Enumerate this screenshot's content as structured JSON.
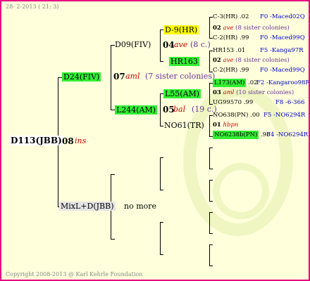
{
  "header_text": "28-  2-2013 ( 21:  3)",
  "copyright": "Copyright 2008-2013 @ Karl Kehrle Foundation",
  "root": {
    "label": "D113(JBB)",
    "year": "08",
    "note": "ins"
  },
  "sire": {
    "label": "D24(FIV)",
    "year": "07",
    "note": "aml",
    "sisters": "(7 sister colonies)"
  },
  "dam_line": {
    "label": "MixL+D(JBB)",
    "note": "no more"
  },
  "gen3": {
    "d09": {
      "label": "D09(FIV)",
      "year": "04",
      "note": "ave",
      "sisters": "(8 c.)"
    },
    "l244": {
      "label": "L244(AM)",
      "year": "05",
      "note": "bal",
      "sisters": "(19 c.)"
    }
  },
  "gen4": {
    "d9": {
      "label": "D-9(HR)",
      "year": "02",
      "note": "ave",
      "sisters": "(8 sister colonies)"
    },
    "hr163": {
      "label": "HR163",
      "year": "02",
      "note": "ave",
      "sisters": "(8 sister colonies)"
    },
    "l55": {
      "label": "L55(AM)",
      "year": "03",
      "note": "aml",
      "sisters": "(10 sister colonies)"
    },
    "no61": {
      "label": "NO61(TR)",
      "year": "01",
      "note": "hbpn"
    }
  },
  "gen5": [
    {
      "name": "C-3(HR)",
      "year": ".02",
      "pedigree": "F0 -Maced02Q"
    },
    {
      "name": "C-2(HR)",
      "year": ".99",
      "pedigree": "F0 -Maced99Q"
    },
    {
      "name": "HR153",
      "year": ".01",
      "pedigree": "F5 -Kanga97R"
    },
    {
      "name": "C-2(HR)",
      "year": ".99",
      "pedigree": "F0 -Maced99Q"
    },
    {
      "name": "L173(AM)",
      "year": ".02",
      "pedigree": "F2 -Kangaroo98R"
    },
    {
      "name": "UG99570",
      "year": ".99",
      "pedigree": "F8 -6-366"
    },
    {
      "name": "NO638(PN)",
      "year": ".00",
      "pedigree": "F5 -NO6294R"
    },
    {
      "name": "NO6238b(PN)",
      "year": ".98",
      "pedigree": "F4 -NO6294R"
    }
  ],
  "colors": {
    "border": "#e6007e",
    "background": "#ffffdc",
    "highlight_green": "#33ee33",
    "highlight_yellow": "#ffff00",
    "link_blue": "#0000cc",
    "note_red": "#cc0000"
  }
}
